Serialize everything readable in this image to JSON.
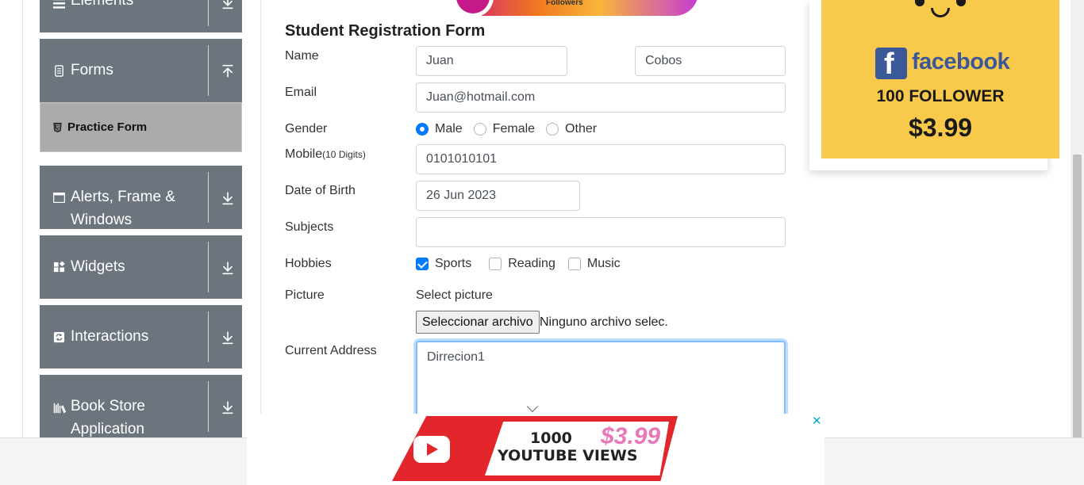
{
  "sidebar": {
    "groups": [
      {
        "label": "Elements",
        "icon": "hamburger-icon"
      },
      {
        "label": "Forms",
        "icon": "document-icon"
      },
      {
        "label": "Alerts, Frame &",
        "label2": "Windows",
        "icon": "window-icon"
      },
      {
        "label": "Widgets",
        "icon": "widgets-icon"
      },
      {
        "label": "Interactions",
        "icon": "interactions-icon"
      },
      {
        "label": "Book Store",
        "label2": "Application",
        "icon": "bookstore-icon"
      }
    ],
    "active_item": {
      "label": "Practice Form",
      "icon": "html5-icon"
    }
  },
  "top_banner": {
    "text": "Followers"
  },
  "form": {
    "title": "Student Registration Form",
    "name_label": "Name",
    "first_name": "Juan",
    "last_name": "Cobos",
    "email_label": "Email",
    "email": "Juan@hotmail.com",
    "gender_label": "Gender",
    "gender_options": [
      "Male",
      "Female",
      "Other"
    ],
    "gender_selected": "Male",
    "mobile_label": "Mobile",
    "mobile_hint": "(10 Digits)",
    "mobile": "0101010101",
    "dob_label": "Date of Birth",
    "dob": "26 Jun 2023",
    "subjects_label": "Subjects",
    "subjects": "",
    "hobbies_label": "Hobbies",
    "hobby_options": [
      "Sports",
      "Reading",
      "Music"
    ],
    "hobbies_checked": [
      "Sports"
    ],
    "picture_label": "Picture",
    "picture_hint": "Select picture",
    "file_button": "Seleccionar archivo",
    "file_status": "Ninguno archivo selec.",
    "address_label": "Current Address",
    "address": "Dirrecion1"
  },
  "ad_right": {
    "brand": "facebook",
    "brand_letter": "f",
    "line": "100 FOLLOWER",
    "price": "$3.99",
    "colors": {
      "bg": "#f8c94a",
      "brand": "#3b5998"
    }
  },
  "ad_bottom": {
    "line1": "1000",
    "line2": "YOUTUBE VIEWS",
    "price": "$3.99",
    "close": "✕"
  },
  "colors": {
    "sidebar": "#6c757d",
    "active": "#ababab",
    "accent": "#007bff"
  }
}
